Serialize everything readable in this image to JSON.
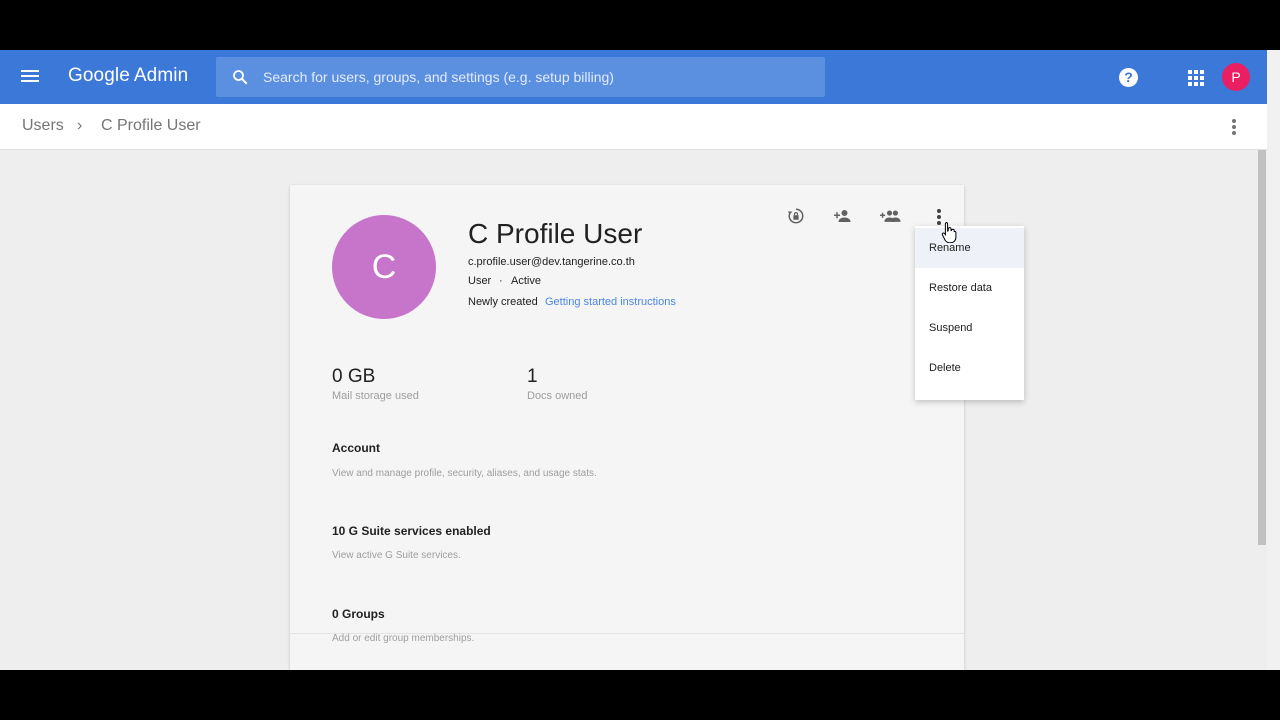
{
  "app": {
    "brand_google": "Google",
    "brand_admin": "Admin",
    "search_placeholder": "Search for users, groups, and settings (e.g. setup billing)",
    "help_glyph": "?",
    "avatar_initial": "P",
    "avatar_color": "#e91e63",
    "header_color": "#3c78d8"
  },
  "breadcrumb": {
    "root": "Users",
    "separator": "›",
    "current": "C Profile User"
  },
  "user": {
    "initial": "C",
    "avatar_color": "#c774cb",
    "name": "C Profile User",
    "email": "c.profile.user@dev.tangerine.co.th",
    "role": "User",
    "dot": "·",
    "status": "Active",
    "newly_created": "Newly created",
    "getting_started_link": "Getting started instructions"
  },
  "stats": [
    {
      "value": "0 GB",
      "label": "Mail storage used"
    },
    {
      "value": "1",
      "label": "Docs owned"
    }
  ],
  "sections": [
    {
      "title": "Account",
      "desc": "View and manage profile, security, aliases, and usage stats."
    },
    {
      "title": "10 G Suite services enabled",
      "desc": "View active G Suite services."
    },
    {
      "title": "0 Groups",
      "desc": "Add or edit group memberships."
    }
  ],
  "actions": [
    "reset-password-icon",
    "add-to-group-icon",
    "add-groups-icon",
    "more-vert-icon"
  ],
  "menu": {
    "items": [
      "Rename",
      "Restore data",
      "Suspend",
      "Delete"
    ],
    "highlighted": "Rename"
  }
}
